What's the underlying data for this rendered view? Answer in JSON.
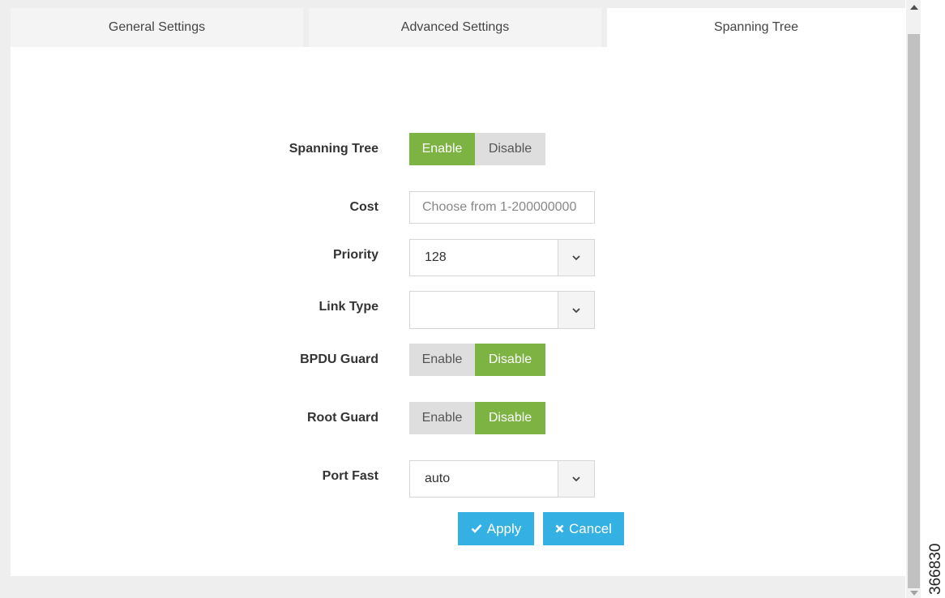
{
  "tabs": [
    {
      "label": "General Settings",
      "active": false
    },
    {
      "label": "Advanced Settings",
      "active": false
    },
    {
      "label": "Spanning Tree",
      "active": true
    }
  ],
  "form": {
    "spanning_tree": {
      "label": "Spanning Tree",
      "options": [
        "Enable",
        "Disable"
      ],
      "selected": "Enable"
    },
    "cost": {
      "label": "Cost",
      "placeholder": "Choose from 1-200000000",
      "value": ""
    },
    "priority": {
      "label": "Priority",
      "value": "128"
    },
    "link_type": {
      "label": "Link Type",
      "value": ""
    },
    "bpdu_guard": {
      "label": "BPDU Guard",
      "options": [
        "Enable",
        "Disable"
      ],
      "selected": "Disable"
    },
    "root_guard": {
      "label": "Root Guard",
      "options": [
        "Enable",
        "Disable"
      ],
      "selected": "Disable"
    },
    "port_fast": {
      "label": "Port Fast",
      "value": "auto"
    }
  },
  "buttons": {
    "apply_label": "Apply",
    "cancel_label": "Cancel"
  },
  "figure_id": "366830",
  "icons": {
    "apply": "checkmark-icon",
    "cancel": "x-icon",
    "select": "chevron-down-icon"
  },
  "colors": {
    "toggle_on": "#7cb342",
    "toggle_off": "#dedede",
    "button": "#35b0e3"
  }
}
